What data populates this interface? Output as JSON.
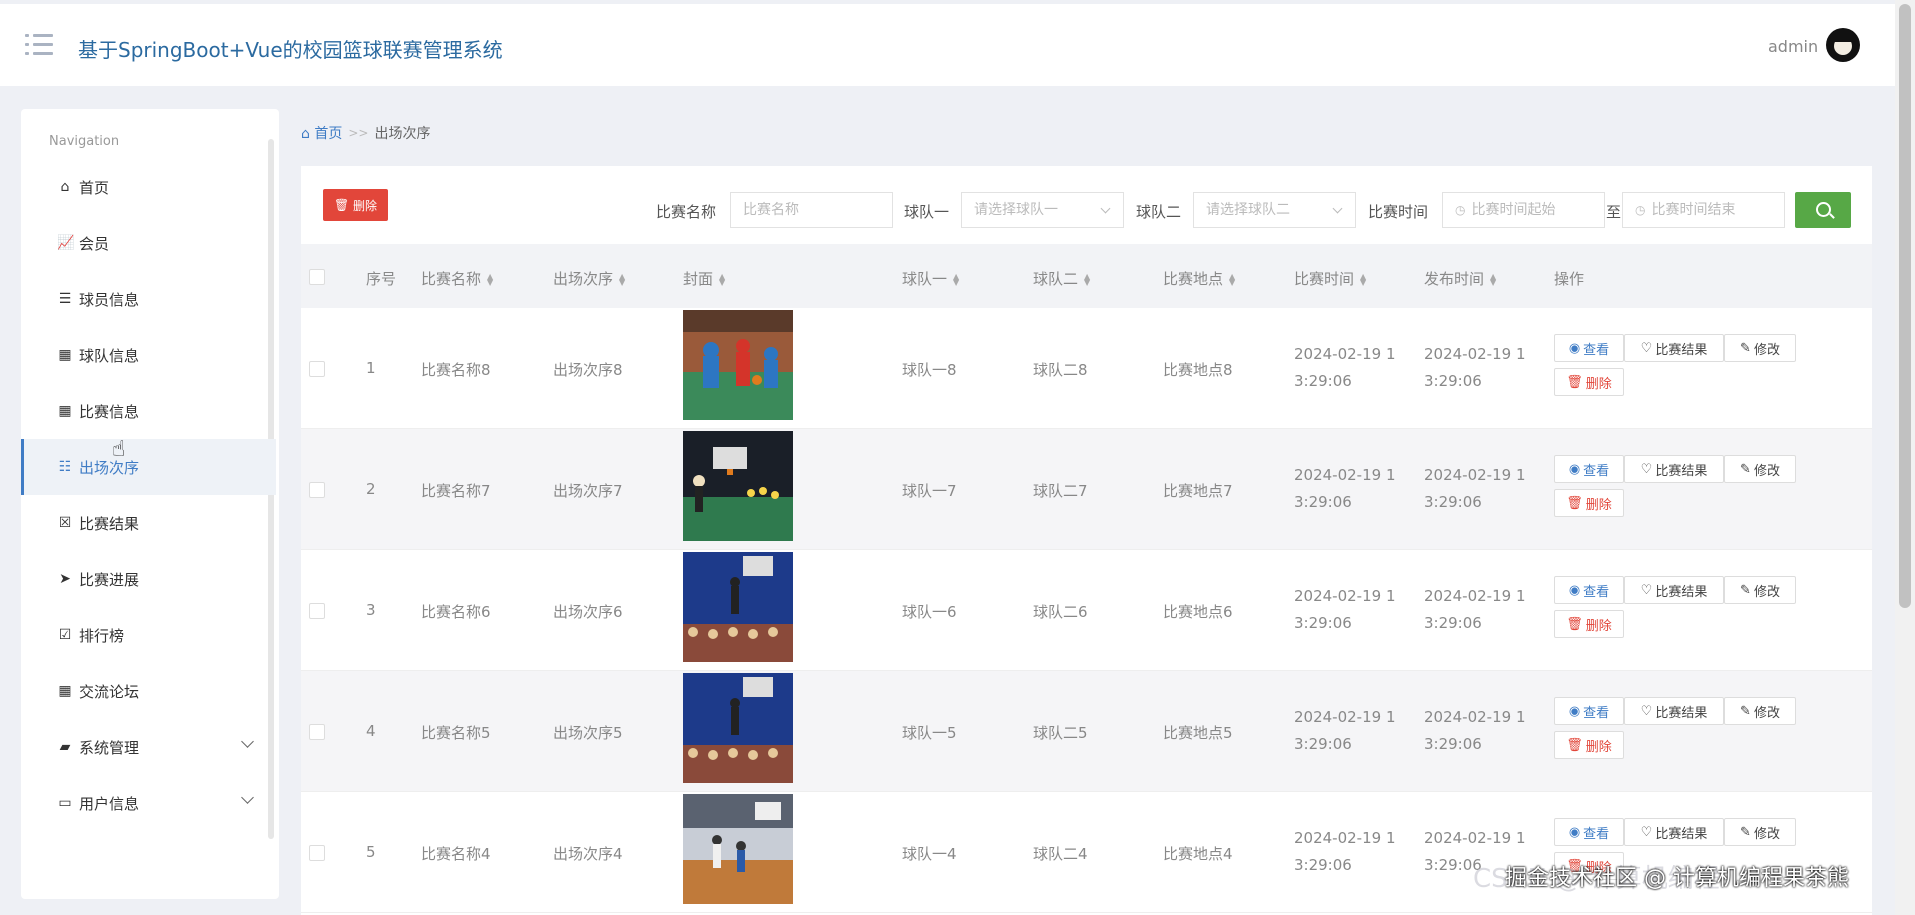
{
  "header": {
    "title": "基于SpringBoot+Vue的校园篮球联赛管理系统",
    "user": "admin"
  },
  "sidebar": {
    "nav_label": "Navigation",
    "items": [
      {
        "label": "首页",
        "icon": "home-icon"
      },
      {
        "label": "会员",
        "icon": "chart-icon"
      },
      {
        "label": "球员信息",
        "icon": "list-icon"
      },
      {
        "label": "球队信息",
        "icon": "grid-icon"
      },
      {
        "label": "比赛信息",
        "icon": "grid-icon"
      },
      {
        "label": "出场次序",
        "icon": "indent-icon",
        "active": true
      },
      {
        "label": "比赛结果",
        "icon": "clipboard-x-icon"
      },
      {
        "label": "比赛进展",
        "icon": "paper-plane-icon"
      },
      {
        "label": "排行榜",
        "icon": "clipboard-check-icon"
      },
      {
        "label": "交流论坛",
        "icon": "grid-icon"
      },
      {
        "label": "系统管理",
        "icon": "comment-icon"
      },
      {
        "label": "用户信息",
        "icon": "card-icon"
      }
    ]
  },
  "breadcrumb": {
    "home": "首页",
    "sep": ">>",
    "current": "出场次序"
  },
  "toolbar": {
    "delete_label": "删除",
    "f1_label": "比赛名称",
    "f1_placeholder": "比赛名称",
    "f2_label": "球队一",
    "f2_placeholder": "请选择球队一",
    "f3_label": "球队二",
    "f3_placeholder": "请选择球队二",
    "f4_label": "比赛时间",
    "f4_start": "比赛时间起始",
    "f4_to": "至",
    "f4_end": "比赛时间结束"
  },
  "table": {
    "headers": [
      "序号",
      "比赛名称",
      "出场次序",
      "封面",
      "球队一",
      "球队二",
      "比赛地点",
      "比赛时间",
      "发布时间",
      "操作"
    ],
    "actions": {
      "view": "查看",
      "result": "比赛结果",
      "edit": "修改",
      "delete": "删除"
    },
    "rows": [
      {
        "no": "1",
        "name": "比赛名称8",
        "order": "出场次序8",
        "team1": "球队一8",
        "team2": "球队二8",
        "place": "比赛地点8",
        "time1": "2024-02-19 1",
        "time2": "3:29:06",
        "pub1": "2024-02-19 1",
        "pub2": "3:29:06"
      },
      {
        "no": "2",
        "name": "比赛名称7",
        "order": "出场次序7",
        "team1": "球队一7",
        "team2": "球队二7",
        "place": "比赛地点7",
        "time1": "2024-02-19 1",
        "time2": "3:29:06",
        "pub1": "2024-02-19 1",
        "pub2": "3:29:06"
      },
      {
        "no": "3",
        "name": "比赛名称6",
        "order": "出场次序6",
        "team1": "球队一6",
        "team2": "球队二6",
        "place": "比赛地点6",
        "time1": "2024-02-19 1",
        "time2": "3:29:06",
        "pub1": "2024-02-19 1",
        "pub2": "3:29:06"
      },
      {
        "no": "4",
        "name": "比赛名称5",
        "order": "出场次序5",
        "team1": "球队一5",
        "team2": "球队二5",
        "place": "比赛地点5",
        "time1": "2024-02-19 1",
        "time2": "3:29:06",
        "pub1": "2024-02-19 1",
        "pub2": "3:29:06"
      },
      {
        "no": "5",
        "name": "比赛名称4",
        "order": "出场次序4",
        "team1": "球队一4",
        "team2": "球队二4",
        "place": "比赛地点4",
        "time1": "2024-02-19 1",
        "time2": "3:29:06",
        "pub1": "2024-02-19 1",
        "pub2": "3:29:06"
      }
    ]
  },
  "watermark": "掘金技术社区 @ 计算机编程果茶熊",
  "watermark_back": "CSDN @ 计算机编程"
}
